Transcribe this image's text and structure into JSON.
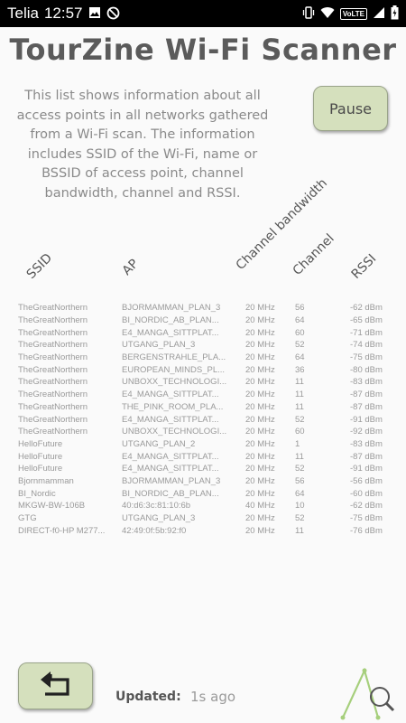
{
  "status_bar": {
    "carrier": "Telia",
    "time": "12:57",
    "volte": "VoLTE",
    "icons_left": [
      "image-icon",
      "do-not-disturb-icon"
    ],
    "icons_right": [
      "vibrate-icon",
      "wifi-icon",
      "signal-icon",
      "battery-charging-icon"
    ]
  },
  "app": {
    "title": "TourZine Wi-Fi Scanner",
    "description": "This list shows information about all access points in all networks gathered from a Wi-Fi scan. The information includes SSID of the Wi-Fi, name or BSSID of access point, channel bandwidth, channel and RSSI.",
    "pause_label": "Pause"
  },
  "table": {
    "headers": {
      "ssid": "SSID",
      "ap": "AP",
      "bandwidth": "Channel bandwidth",
      "channel": "Channel",
      "rssi": "RSSI"
    },
    "rows": [
      {
        "ssid": "TheGreatNorthern",
        "ap": "BJORMAMMAN_PLAN_3",
        "bw": "20 MHz",
        "ch": "56",
        "rssi": "-62 dBm"
      },
      {
        "ssid": "TheGreatNorthern",
        "ap": "BI_NORDIC_AB_PLAN...",
        "bw": "20 MHz",
        "ch": "64",
        "rssi": "-65 dBm"
      },
      {
        "ssid": "TheGreatNorthern",
        "ap": "E4_MANGA_SITTPLAT...",
        "bw": "20 MHz",
        "ch": "60",
        "rssi": "-71 dBm"
      },
      {
        "ssid": "TheGreatNorthern",
        "ap": "UTGANG_PLAN_3",
        "bw": "20 MHz",
        "ch": "52",
        "rssi": "-74 dBm"
      },
      {
        "ssid": "TheGreatNorthern",
        "ap": "BERGENSTRAHLE_PLA...",
        "bw": "20 MHz",
        "ch": "64",
        "rssi": "-75 dBm"
      },
      {
        "ssid": "TheGreatNorthern",
        "ap": "EUROPEAN_MINDS_PL...",
        "bw": "20 MHz",
        "ch": "36",
        "rssi": "-80 dBm"
      },
      {
        "ssid": "TheGreatNorthern",
        "ap": "UNBOXX_TECHNOLOGI...",
        "bw": "20 MHz",
        "ch": "11",
        "rssi": "-83 dBm"
      },
      {
        "ssid": "TheGreatNorthern",
        "ap": "E4_MANGA_SITTPLAT...",
        "bw": "20 MHz",
        "ch": "11",
        "rssi": "-87 dBm"
      },
      {
        "ssid": "TheGreatNorthern",
        "ap": "THE_PINK_ROOM_PLA...",
        "bw": "20 MHz",
        "ch": "11",
        "rssi": "-87 dBm"
      },
      {
        "ssid": "TheGreatNorthern",
        "ap": "E4_MANGA_SITTPLAT...",
        "bw": "20 MHz",
        "ch": "52",
        "rssi": "-91 dBm"
      },
      {
        "ssid": "TheGreatNorthern",
        "ap": "UNBOXX_TECHNOLOGI...",
        "bw": "20 MHz",
        "ch": "60",
        "rssi": "-92 dBm"
      },
      {
        "ssid": "HelloFuture",
        "ap": "UTGANG_PLAN_2",
        "bw": "20 MHz",
        "ch": "1",
        "rssi": "-83 dBm"
      },
      {
        "ssid": "HelloFuture",
        "ap": "E4_MANGA_SITTPLAT...",
        "bw": "20 MHz",
        "ch": "11",
        "rssi": "-87 dBm"
      },
      {
        "ssid": "HelloFuture",
        "ap": "E4_MANGA_SITTPLAT...",
        "bw": "20 MHz",
        "ch": "52",
        "rssi": "-91 dBm"
      },
      {
        "ssid": "Bjornmamman",
        "ap": "BJORMAMMAN_PLAN_3",
        "bw": "20 MHz",
        "ch": "56",
        "rssi": "-56 dBm"
      },
      {
        "ssid": "BI_Nordic",
        "ap": "BI_NORDIC_AB_PLAN...",
        "bw": "20 MHz",
        "ch": "64",
        "rssi": "-60 dBm"
      },
      {
        "ssid": "MKGW-BW-106B",
        "ap": "40:d6:3c:81:10:6b",
        "bw": "40 MHz",
        "ch": "10",
        "rssi": "-62 dBm"
      },
      {
        "ssid": "GTG",
        "ap": "UTGANG_PLAN_3",
        "bw": "20 MHz",
        "ch": "52",
        "rssi": "-75 dBm"
      },
      {
        "ssid": "DIRECT-f0-HP M277...",
        "ap": "42:49:0f:5b:92:f0",
        "bw": "20 MHz",
        "ch": "11",
        "rssi": "-76 dBm"
      }
    ]
  },
  "footer": {
    "updated_label": "Updated:",
    "updated_value": "1s ago",
    "back_icon": "return-arrow-icon",
    "logo_icon": "scanner-logo-icon"
  },
  "colors": {
    "button_bg": "#d5e0bd",
    "logo_green": "#a6cf7c",
    "status_bar": "#000000"
  }
}
